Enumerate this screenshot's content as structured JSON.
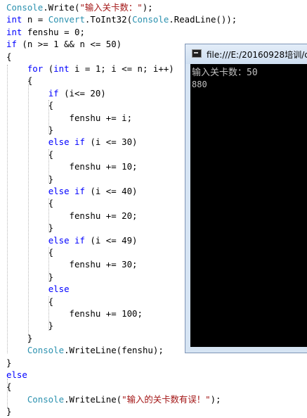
{
  "editor": {
    "lines": [
      {
        "id": "l1",
        "tokens": [
          {
            "t": "Console",
            "c": "ty"
          },
          {
            "t": ".Write(",
            "c": ""
          },
          {
            "t": "\"输入关卡数：\"",
            "c": "str"
          },
          {
            "t": ");",
            "c": ""
          }
        ]
      },
      {
        "id": "l2",
        "tokens": [
          {
            "t": "int",
            "c": "kw"
          },
          {
            "t": " n = ",
            "c": ""
          },
          {
            "t": "Convert",
            "c": "ty"
          },
          {
            "t": ".ToInt32(",
            "c": ""
          },
          {
            "t": "Console",
            "c": "ty"
          },
          {
            "t": ".ReadLine());",
            "c": ""
          }
        ]
      },
      {
        "id": "l3",
        "tokens": [
          {
            "t": "int",
            "c": "kw"
          },
          {
            "t": " fenshu = 0;",
            "c": ""
          }
        ]
      },
      {
        "id": "l4",
        "tokens": [
          {
            "t": "if",
            "c": "kw"
          },
          {
            "t": " (n >= 1 && n <= 50)",
            "c": ""
          }
        ]
      },
      {
        "id": "l5",
        "tokens": [
          {
            "t": "{",
            "c": ""
          }
        ]
      },
      {
        "id": "l6",
        "tokens": [
          {
            "t": "    ",
            "c": ""
          },
          {
            "t": "for",
            "c": "kw"
          },
          {
            "t": " (",
            "c": ""
          },
          {
            "t": "int",
            "c": "kw"
          },
          {
            "t": " i = 1; i <= n; i++)",
            "c": ""
          }
        ]
      },
      {
        "id": "l7",
        "tokens": [
          {
            "t": "    {",
            "c": ""
          }
        ]
      },
      {
        "id": "l8",
        "tokens": [
          {
            "t": "        ",
            "c": ""
          },
          {
            "t": "if",
            "c": "kw"
          },
          {
            "t": " (i<= 20)",
            "c": ""
          }
        ]
      },
      {
        "id": "l9",
        "tokens": [
          {
            "t": "        {",
            "c": ""
          }
        ]
      },
      {
        "id": "l10",
        "tokens": [
          {
            "t": "            fenshu += i;",
            "c": ""
          }
        ]
      },
      {
        "id": "l11",
        "tokens": [
          {
            "t": "        }",
            "c": ""
          }
        ]
      },
      {
        "id": "l12",
        "tokens": [
          {
            "t": "        ",
            "c": ""
          },
          {
            "t": "else",
            "c": "kw"
          },
          {
            "t": " ",
            "c": ""
          },
          {
            "t": "if",
            "c": "kw"
          },
          {
            "t": " (i <= 30)",
            "c": ""
          }
        ]
      },
      {
        "id": "l13",
        "tokens": [
          {
            "t": "        {",
            "c": ""
          }
        ]
      },
      {
        "id": "l14",
        "tokens": [
          {
            "t": "            fenshu += 10;",
            "c": ""
          }
        ]
      },
      {
        "id": "l15",
        "tokens": [
          {
            "t": "        }",
            "c": ""
          }
        ]
      },
      {
        "id": "l16",
        "tokens": [
          {
            "t": "        ",
            "c": ""
          },
          {
            "t": "else",
            "c": "kw"
          },
          {
            "t": " ",
            "c": ""
          },
          {
            "t": "if",
            "c": "kw"
          },
          {
            "t": " (i <= 40)",
            "c": ""
          }
        ]
      },
      {
        "id": "l17",
        "tokens": [
          {
            "t": "        {",
            "c": ""
          }
        ]
      },
      {
        "id": "l18",
        "tokens": [
          {
            "t": "            fenshu += 20;",
            "c": ""
          }
        ]
      },
      {
        "id": "l19",
        "tokens": [
          {
            "t": "        }",
            "c": ""
          }
        ]
      },
      {
        "id": "l20",
        "tokens": [
          {
            "t": "        ",
            "c": ""
          },
          {
            "t": "else",
            "c": "kw"
          },
          {
            "t": " ",
            "c": ""
          },
          {
            "t": "if",
            "c": "kw"
          },
          {
            "t": " (i <= 49)",
            "c": ""
          }
        ]
      },
      {
        "id": "l21",
        "tokens": [
          {
            "t": "        {",
            "c": ""
          }
        ]
      },
      {
        "id": "l22",
        "tokens": [
          {
            "t": "            fenshu += 30;",
            "c": ""
          }
        ]
      },
      {
        "id": "l23",
        "tokens": [
          {
            "t": "        }",
            "c": ""
          }
        ]
      },
      {
        "id": "l24",
        "tokens": [
          {
            "t": "        ",
            "c": ""
          },
          {
            "t": "else",
            "c": "kw"
          }
        ]
      },
      {
        "id": "l25",
        "tokens": [
          {
            "t": "        {",
            "c": ""
          }
        ]
      },
      {
        "id": "l26",
        "tokens": [
          {
            "t": "            fenshu += 100;",
            "c": ""
          }
        ]
      },
      {
        "id": "l27",
        "tokens": [
          {
            "t": "        }",
            "c": ""
          }
        ]
      },
      {
        "id": "l28",
        "tokens": [
          {
            "t": "    }",
            "c": ""
          }
        ]
      },
      {
        "id": "l29",
        "tokens": [
          {
            "t": "    ",
            "c": ""
          },
          {
            "t": "Console",
            "c": "ty"
          },
          {
            "t": ".WriteLine(fenshu);",
            "c": ""
          }
        ]
      },
      {
        "id": "l30",
        "tokens": [
          {
            "t": "}",
            "c": ""
          }
        ]
      },
      {
        "id": "l31",
        "tokens": [
          {
            "t": "else",
            "c": "kw"
          }
        ]
      },
      {
        "id": "l32",
        "tokens": [
          {
            "t": "{",
            "c": ""
          }
        ]
      },
      {
        "id": "l33",
        "tokens": [
          {
            "t": "    ",
            "c": ""
          },
          {
            "t": "Console",
            "c": "ty"
          },
          {
            "t": ".WriteLine(",
            "c": ""
          },
          {
            "t": "\"输入的关卡数有误！\"",
            "c": "str"
          },
          {
            "t": ");",
            "c": ""
          }
        ]
      },
      {
        "id": "l34",
        "tokens": [
          {
            "t": "}",
            "c": ""
          }
        ]
      }
    ]
  },
  "console_window": {
    "title": "file:///E:/20160928培训/c",
    "icon": "console-app-icon",
    "output_lines": [
      "输入关卡数：50",
      "880"
    ]
  },
  "colors": {
    "keyword": "#0000ff",
    "type": "#2b91af",
    "string": "#a31515",
    "console_bg": "#000000",
    "console_text": "#c0c0c0",
    "titlebar": "#d6e4f3"
  }
}
